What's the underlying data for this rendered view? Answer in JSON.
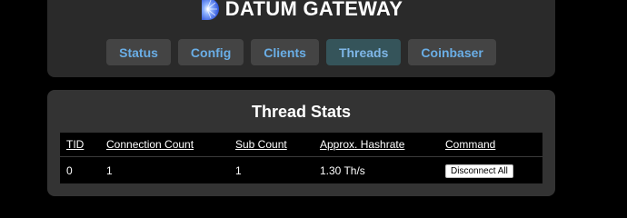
{
  "header": {
    "title": "DATUM GATEWAY",
    "logo_icon": "datum-logo-icon",
    "colors": {
      "panel_bg": "#2a2a2a",
      "tab_bg": "#444444",
      "tab_active_bg": "#35545a",
      "tab_text": "#6aaee6"
    }
  },
  "nav": {
    "tabs": [
      {
        "label": "Status",
        "active": false
      },
      {
        "label": "Config",
        "active": false
      },
      {
        "label": "Clients",
        "active": false
      },
      {
        "label": "Threads",
        "active": true
      },
      {
        "label": "Coinbaser",
        "active": false
      }
    ]
  },
  "thread_stats": {
    "title": "Thread Stats",
    "columns": [
      "TID",
      "Connection Count",
      "Sub Count",
      "Approx. Hashrate",
      "Command"
    ],
    "rows": [
      {
        "tid": "0",
        "connection_count": "1",
        "sub_count": "1",
        "hashrate": "1.30 Th/s",
        "command_label": "Disconnect All"
      }
    ]
  }
}
